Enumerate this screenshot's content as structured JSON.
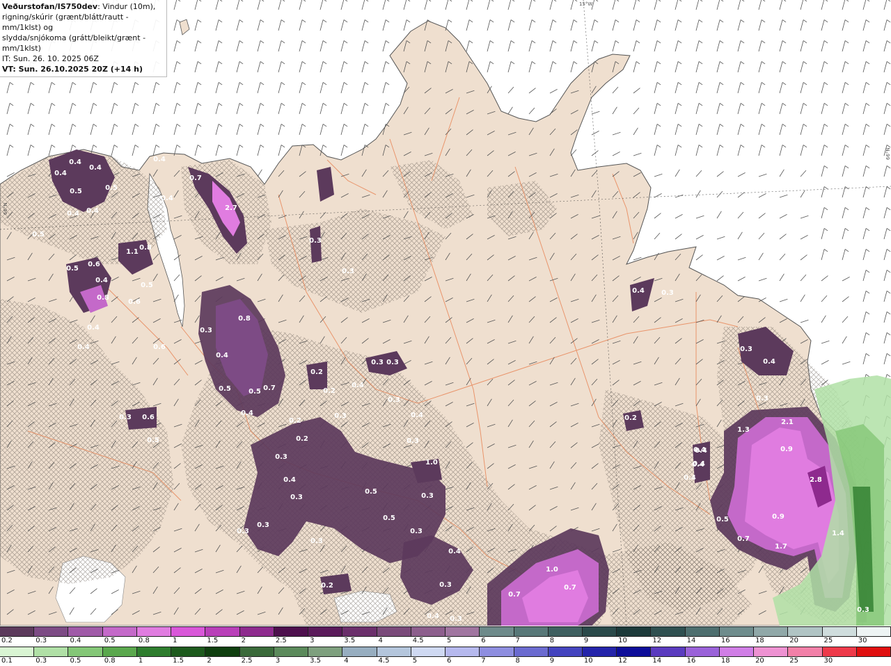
{
  "header": {
    "brand": "Veðurstofan/IS750dev",
    "line1_rest": ": Vindur (10m),",
    "line2": "rigning/skúrir (grænt/blátt/rautt - mm/1klst) og",
    "line3": "slydda/snjókoma (grátt/bleikt/grænt - mm/1klst)",
    "init_time": "IT: Sun. 26. 10. 2025 06Z",
    "valid_time": "VT: Sun. 26.10.2025 20Z (+14 h)"
  },
  "graticule": {
    "lat_left": "66°N",
    "lat_right": "66°N",
    "lon_top": "15°W"
  },
  "map_labels": [
    {
      "text": "0.4"
    },
    {
      "text": "0.4"
    },
    {
      "text": "0.4"
    },
    {
      "text": "0.5"
    },
    {
      "text": "0.4"
    },
    {
      "text": "0.4"
    },
    {
      "text": "0.5"
    },
    {
      "text": "0.4"
    },
    {
      "text": "0.4"
    },
    {
      "text": "0.7"
    },
    {
      "text": "2.7"
    },
    {
      "text": "0.5"
    },
    {
      "text": "1.1"
    },
    {
      "text": "0.8"
    },
    {
      "text": "0.5"
    },
    {
      "text": "0.6"
    },
    {
      "text": "0.4"
    },
    {
      "text": "0.8"
    },
    {
      "text": "0.5"
    },
    {
      "text": "0.6"
    },
    {
      "text": "0.4"
    },
    {
      "text": "0.4"
    },
    {
      "text": "0.6"
    },
    {
      "text": "0.3"
    },
    {
      "text": "0.4"
    },
    {
      "text": "0.5"
    },
    {
      "text": "0.5"
    },
    {
      "text": "0.4"
    },
    {
      "text": "0.7"
    },
    {
      "text": "0.3"
    },
    {
      "text": "0.8"
    },
    {
      "text": "0.3"
    },
    {
      "text": "0.4"
    },
    {
      "text": "0.3"
    },
    {
      "text": "0.3"
    },
    {
      "text": "0.3"
    },
    {
      "text": "0.6"
    },
    {
      "text": "0.5"
    },
    {
      "text": "0.2"
    },
    {
      "text": "0.2"
    },
    {
      "text": "0.3"
    },
    {
      "text": "0.2"
    },
    {
      "text": "0.4"
    },
    {
      "text": "0.3"
    },
    {
      "text": "0.4"
    },
    {
      "text": "0.3"
    },
    {
      "text": "0.5"
    },
    {
      "text": "0.3"
    },
    {
      "text": "0.3"
    },
    {
      "text": "0.3"
    },
    {
      "text": "0.5"
    },
    {
      "text": "0.3"
    },
    {
      "text": "0.4"
    },
    {
      "text": "0.3"
    },
    {
      "text": "1.0"
    },
    {
      "text": "0.2"
    },
    {
      "text": "0.4"
    },
    {
      "text": "0.3"
    },
    {
      "text": "0.3"
    },
    {
      "text": "0.2"
    },
    {
      "text": "0.3"
    },
    {
      "text": "0.4"
    },
    {
      "text": "1.0"
    },
    {
      "text": "0.7"
    },
    {
      "text": "0.7"
    },
    {
      "text": "0.3"
    },
    {
      "text": "0.4"
    },
    {
      "text": "0.4"
    },
    {
      "text": "0.3"
    },
    {
      "text": "0.4"
    },
    {
      "text": "0.2"
    },
    {
      "text": "0.3"
    },
    {
      "text": "1.3"
    },
    {
      "text": "2.1"
    },
    {
      "text": "0.9"
    },
    {
      "text": "0.4"
    },
    {
      "text": "0.4"
    },
    {
      "text": "0.4"
    },
    {
      "text": "2.8"
    },
    {
      "text": "0.5"
    },
    {
      "text": "0.9"
    },
    {
      "text": "1.4"
    },
    {
      "text": "0.7"
    },
    {
      "text": "1.7"
    },
    {
      "text": "0.3"
    },
    {
      "text": "0.3"
    }
  ],
  "legend_snow": {
    "ticks": [
      "0.2",
      "0.3",
      "0.4",
      "0.5",
      "0.8",
      "1",
      "1.5",
      "2",
      "2.5",
      "3",
      "3.5",
      "4",
      "4.5",
      "5",
      "6",
      "7",
      "8",
      "9",
      "10",
      "12",
      "14",
      "16",
      "18",
      "20",
      "25",
      "30"
    ],
    "colors": [
      "#5c3a5c",
      "#7d4b85",
      "#a05aa8",
      "#c469c9",
      "#e07ce0",
      "#d957d9",
      "#b93fb9",
      "#8e2a8e",
      "#4d0f4d",
      "#5a1a5a",
      "#6b2f6b",
      "#7a4a7a",
      "#8d5f8d",
      "#a075a0",
      "#6e8a8a",
      "#587878",
      "#3f6060",
      "#2a4a4a",
      "#1c3a3a",
      "#2f5050",
      "#4d6e6e",
      "#6e8c8c",
      "#90a8a8",
      "#b0c4c4",
      "#cfdddd",
      "#eef4f4"
    ]
  },
  "legend_rain": {
    "ticks": [
      "0.1",
      "0.3",
      "0.5",
      "0.8",
      "1",
      "1.5",
      "2",
      "2.5",
      "3",
      "3.5",
      "4",
      "4.5",
      "5",
      "6",
      "7",
      "8",
      "9",
      "10",
      "12",
      "14",
      "16",
      "18",
      "20",
      "25",
      "30"
    ],
    "colors": [
      "#d9f5d3",
      "#b0e0a6",
      "#84c777",
      "#5aa84d",
      "#2e7d2e",
      "#1d5a1d",
      "#0f3f0f",
      "#3a6a3a",
      "#5b8a5b",
      "#7ea07e",
      "#97aec0",
      "#b4c6dc",
      "#cfd9f2",
      "#b6b9ee",
      "#8e8ee0",
      "#6b6bd0",
      "#4444bf",
      "#2424aa",
      "#0d0d99",
      "#5a3bbf",
      "#9a62d9",
      "#d07ee6",
      "#ee92d2",
      "#f280a8",
      "#ee3a4a",
      "#e01010"
    ]
  }
}
